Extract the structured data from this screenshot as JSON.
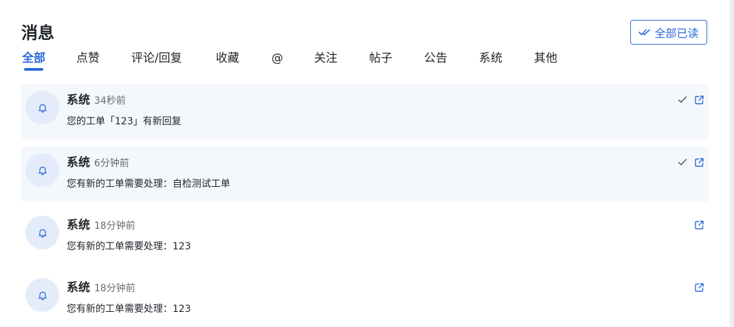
{
  "page": {
    "title": "消息",
    "mark_all_read_label": "全部已读"
  },
  "tabs": [
    {
      "label": "全部",
      "active": true
    },
    {
      "label": "点赞"
    },
    {
      "label": "评论/回复"
    },
    {
      "label": "收藏"
    },
    {
      "label": "@"
    },
    {
      "label": "关注"
    },
    {
      "label": "帖子"
    },
    {
      "label": "公告"
    },
    {
      "label": "系统"
    },
    {
      "label": "其他"
    }
  ],
  "notifications": [
    {
      "sender": "系统",
      "time": "34秒前",
      "message": "您的工单「123」有新回复",
      "unread": true,
      "icon": "bell-icon"
    },
    {
      "sender": "系统",
      "time": "6分钟前",
      "message": "您有新的工单需要处理：自检测试工单",
      "unread": true,
      "icon": "bell-icon"
    },
    {
      "sender": "系统",
      "time": "18分钟前",
      "message": "您有新的工单需要处理：123",
      "unread": false,
      "icon": "bell-icon"
    },
    {
      "sender": "系统",
      "time": "18分钟前",
      "message": "您有新的工单需要处理：123",
      "unread": false,
      "icon": "bell-icon"
    }
  ],
  "colors": {
    "accent": "#2f6bd8",
    "unread_bg": "#f4f7fc",
    "avatar_bg": "#e4ebfa"
  }
}
